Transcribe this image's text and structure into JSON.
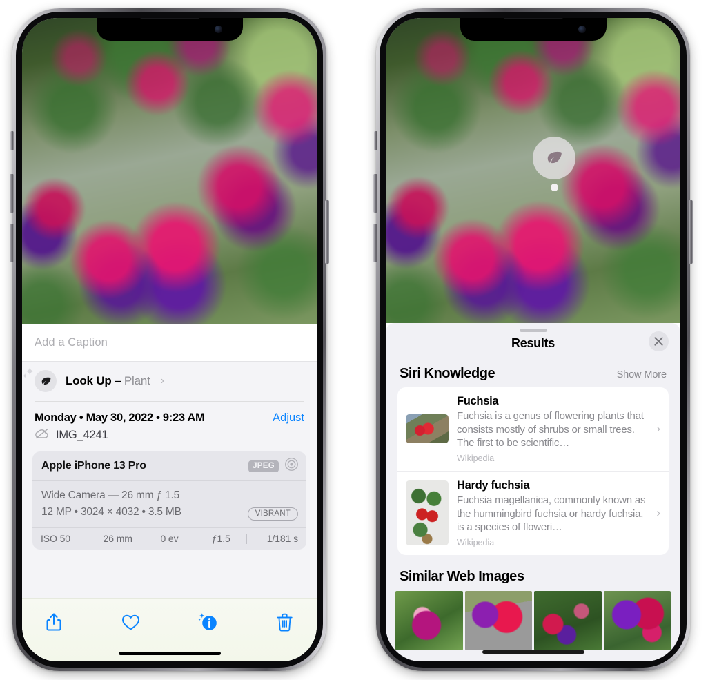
{
  "left_phone": {
    "caption": {
      "placeholder": "Add a Caption",
      "value": ""
    },
    "lookup": {
      "label": "Look Up – ",
      "subject": "Plant",
      "icon": "leaf-icon",
      "chevron": "›"
    },
    "date_row": {
      "date": "Monday • May 30, 2022 • 9:23 AM",
      "adjust_label": "Adjust"
    },
    "file_row": {
      "icon": "cloud-slash-icon",
      "filename": "IMG_4241"
    },
    "exif": {
      "device": "Apple iPhone 13 Pro",
      "format_badge": "JPEG",
      "lens_icon": "aperture-icon",
      "lens_line": "Wide Camera — 26 mm ƒ 1.5",
      "specs_line": "12 MP • 3024 × 4032 • 3.5 MB",
      "style_badge": "VIBRANT",
      "stats": [
        "ISO 50",
        "26 mm",
        "0 ev",
        "ƒ1.5",
        "1/181 s"
      ]
    },
    "toolbar": [
      {
        "name": "share-button",
        "icon": "share-icon"
      },
      {
        "name": "favorite-button",
        "icon": "heart-icon"
      },
      {
        "name": "info-button",
        "icon": "info-sparkle-icon",
        "active": true
      },
      {
        "name": "delete-button",
        "icon": "trash-icon"
      }
    ],
    "map": {
      "pin_label": "photo-pin"
    }
  },
  "right_phone": {
    "leaf_badge": {
      "icon": "leaf-icon"
    },
    "sheet": {
      "title": "Results",
      "close_icon": "close-icon",
      "siri_section": {
        "title": "Siri Knowledge",
        "action": "Show More",
        "items": [
          {
            "title": "Fuchsia",
            "description": "Fuchsia is a genus of flowering plants that consists mostly of shrubs or small trees. The first to be scientific…",
            "source": "Wikipedia",
            "chevron": "›"
          },
          {
            "title": "Hardy fuchsia",
            "description": "Fuchsia magellanica, commonly known as the hummingbird fuchsia or hardy fuchsia, is a species of floweri…",
            "source": "Wikipedia",
            "chevron": "›"
          }
        ]
      },
      "web_section": {
        "title": "Similar Web Images",
        "image_count": 4
      }
    }
  },
  "colors": {
    "accent_blue": "#0a84ff",
    "sheet_gray": "#f1f1f5",
    "card_white": "#ffffff",
    "secondary_text": "#8a8a8f",
    "exif_card": "#e6e6eb"
  }
}
